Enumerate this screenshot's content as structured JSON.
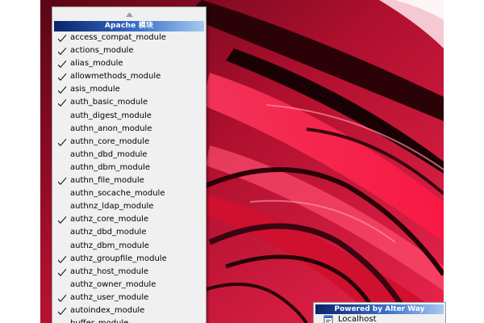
{
  "menu": {
    "title": "Apache 模块",
    "items": [
      {
        "label": "access_compat_module",
        "checked": true
      },
      {
        "label": "actions_module",
        "checked": true
      },
      {
        "label": "alias_module",
        "checked": true
      },
      {
        "label": "allowmethods_module",
        "checked": true
      },
      {
        "label": "asis_module",
        "checked": true
      },
      {
        "label": "auth_basic_module",
        "checked": true
      },
      {
        "label": "auth_digest_module",
        "checked": false
      },
      {
        "label": "authn_anon_module",
        "checked": false
      },
      {
        "label": "authn_core_module",
        "checked": true
      },
      {
        "label": "authn_dbd_module",
        "checked": false
      },
      {
        "label": "authn_dbm_module",
        "checked": false
      },
      {
        "label": "authn_file_module",
        "checked": true
      },
      {
        "label": "authn_socache_module",
        "checked": false
      },
      {
        "label": "authnz_ldap_module",
        "checked": false
      },
      {
        "label": "authz_core_module",
        "checked": true
      },
      {
        "label": "authz_dbd_module",
        "checked": false
      },
      {
        "label": "authz_dbm_module",
        "checked": false
      },
      {
        "label": "authz_groupfile_module",
        "checked": true
      },
      {
        "label": "authz_host_module",
        "checked": true
      },
      {
        "label": "authz_owner_module",
        "checked": false
      },
      {
        "label": "authz_user_module",
        "checked": true
      },
      {
        "label": "autoindex_module",
        "checked": true
      },
      {
        "label": "buffer_module",
        "checked": false
      }
    ]
  },
  "tray": {
    "title": "Powered by Alter Way",
    "localhost_label": "Localhost"
  },
  "icons": {
    "scroll_up": "triangle-up-icon",
    "check": "checkmark-icon",
    "localhost": "server-icon"
  },
  "colors": {
    "menu_bg": "#f0f0f0",
    "title_gradient_start": "#0a246a",
    "title_gradient_end": "#a6caf0",
    "wallpaper_dark": "#7a0a1e",
    "wallpaper_bright": "#ff2a55"
  }
}
